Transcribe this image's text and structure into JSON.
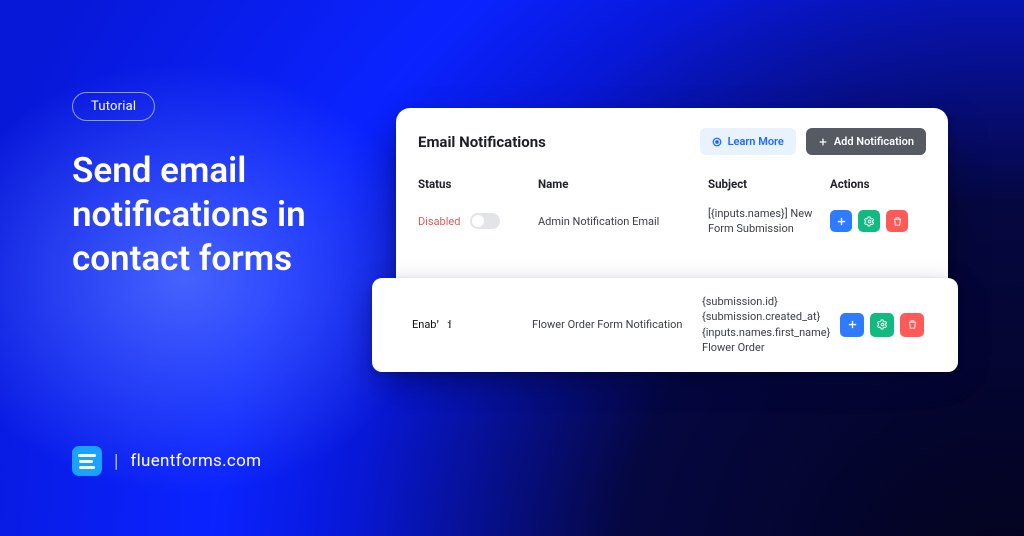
{
  "hero": {
    "pill": "Tutorial",
    "headline": "Send email notifications in contact forms"
  },
  "brand": {
    "site": "fluentforms.com"
  },
  "panel": {
    "title": "Email Notifications",
    "learn_more": "Learn More",
    "add_notification": "Add Notification",
    "columns": {
      "status": "Status",
      "name": "Name",
      "subject": "Subject",
      "actions": "Actions"
    },
    "rows": [
      {
        "status_label": "Disabled",
        "enabled": false,
        "name": "Admin Notification Email",
        "subject": "[{inputs.names}] New Form Submission"
      },
      {
        "status_label": "Enabled",
        "enabled": true,
        "name": "Flower Order Form Notification",
        "subject": "{submission.id} {submission.created_at} {inputs.names.first_name} Flower Order"
      }
    ],
    "icons": {
      "duplicate": "plus-icon",
      "settings": "gear-icon",
      "delete": "trash-icon",
      "learn": "target-icon",
      "add": "plus-icon"
    }
  }
}
